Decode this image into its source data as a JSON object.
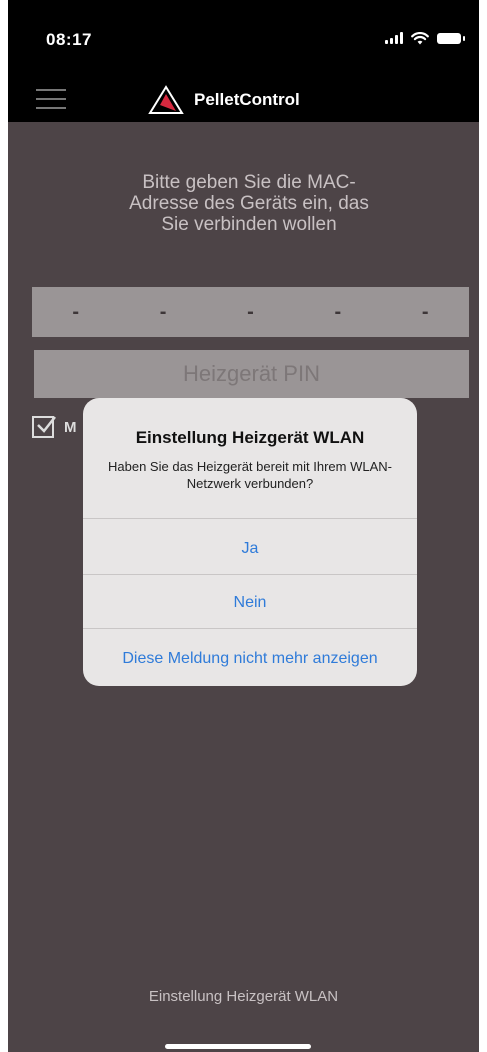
{
  "status_bar": {
    "time": "08:17"
  },
  "nav": {
    "app_name": "PelletControl"
  },
  "main": {
    "instruction": "Bitte geben Sie die MAC-Adresse des Geräts ein, das Sie verbinden wollen",
    "mac_placeholder": [
      "-",
      "-",
      "-",
      "-",
      "-"
    ],
    "pin_placeholder": "Heizgerät PIN",
    "checkbox_label": "M",
    "footer_label": "Einstellung Heizgerät WLAN"
  },
  "alert": {
    "title": "Einstellung Heizgerät WLAN",
    "message": "Haben Sie das Heizgerät bereit mit Ihrem WLAN-Netzwerk verbunden?",
    "buttons": [
      "Ja",
      "Nein",
      "Diese Meldung nicht mehr anzeigen"
    ]
  },
  "colors": {
    "background": "#4d4447",
    "header": "#000000",
    "field": "#9a9596",
    "alert_background": "#e8e6e6",
    "alert_button": "#2f7bd9",
    "brand_logo": "#d6293f"
  },
  "icons": [
    "menu-icon",
    "pelletcontrol-logo-icon",
    "signal-icon",
    "wifi-icon",
    "battery-icon",
    "checkmark-icon"
  ]
}
